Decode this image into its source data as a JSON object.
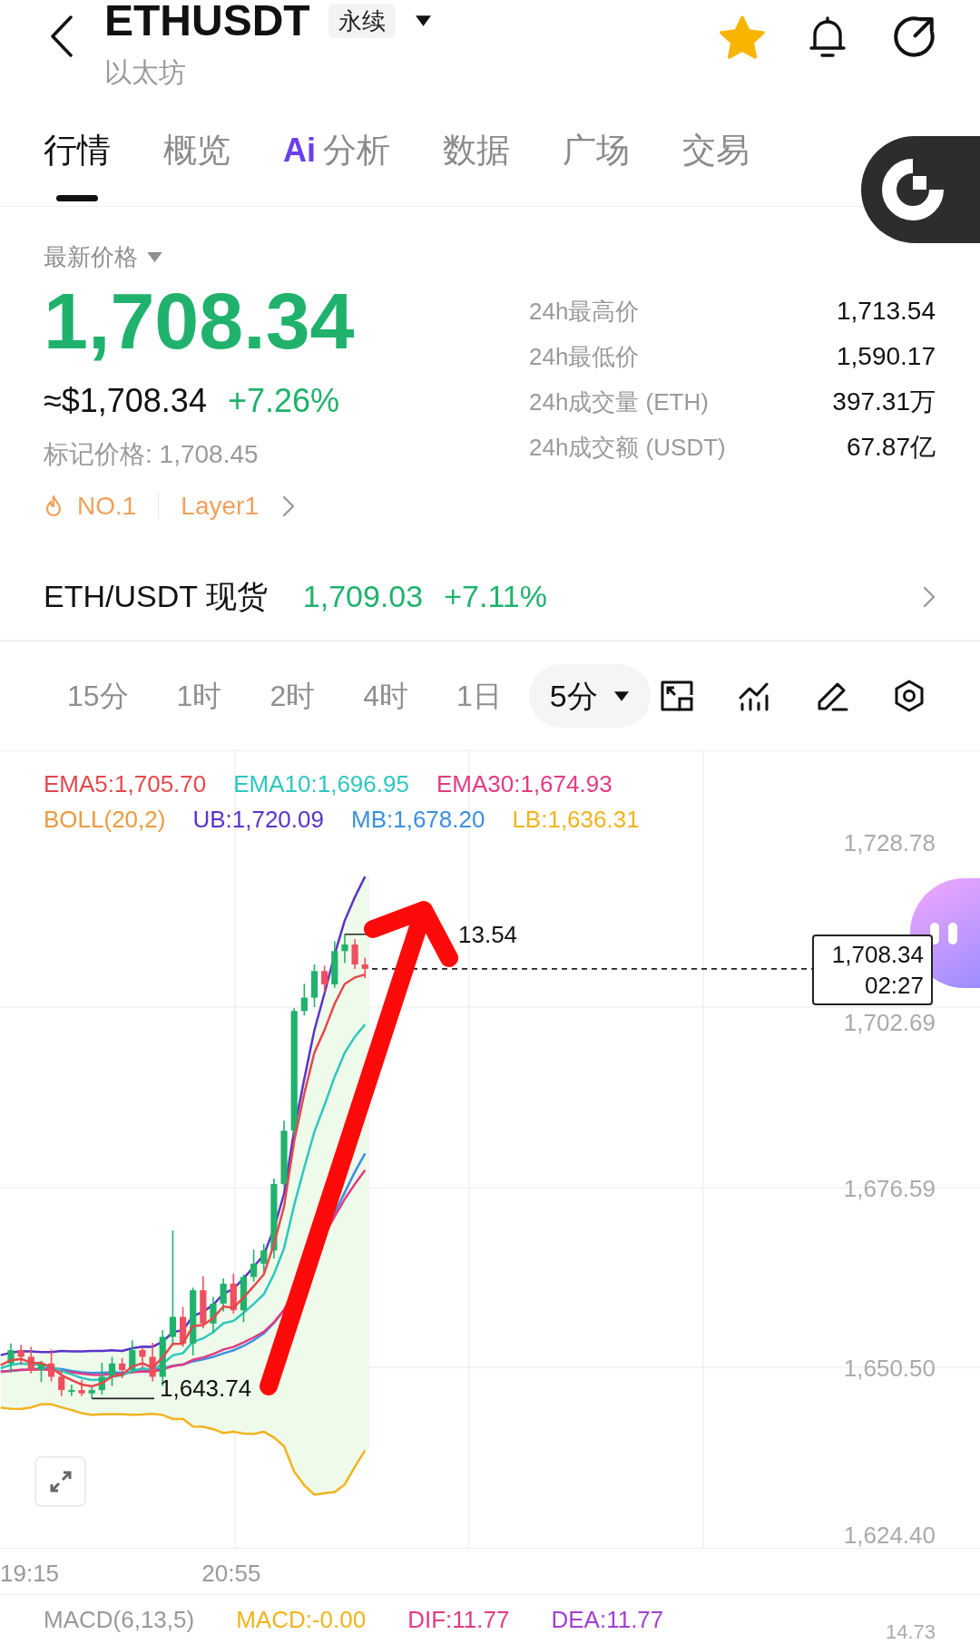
{
  "header": {
    "title": "ETHUSDT",
    "contract_badge": "永续",
    "subtitle": "以太坊",
    "favorite": true
  },
  "tabs": [
    {
      "label": "行情",
      "selected": true
    },
    {
      "label": "概览",
      "selected": false
    },
    {
      "label": "分析",
      "badge": "Ai",
      "selected": false
    },
    {
      "label": "数据",
      "selected": false
    },
    {
      "label": "广场",
      "selected": false
    },
    {
      "label": "交易",
      "selected": false
    }
  ],
  "price": {
    "label": "最新价格",
    "last": "1,708.34",
    "usd": "≈$1,708.34",
    "change": "+7.26%",
    "mark": "标记价格: 1,708.45",
    "tags": [
      {
        "kind": "rank",
        "text": "NO.1"
      },
      {
        "kind": "sector",
        "text": "Layer1"
      }
    ]
  },
  "stats": [
    {
      "label": "24h最高价",
      "value": "1,713.54"
    },
    {
      "label": "24h最低价",
      "value": "1,590.17"
    },
    {
      "label": "24h成交量 (ETH)",
      "value": "397.31万"
    },
    {
      "label": "24h成交额 (USDT)",
      "value": "67.87亿"
    }
  ],
  "spot": {
    "label": "ETH/USDT 现货",
    "price": "1,709.03",
    "change": "+7.11%"
  },
  "intervals": [
    {
      "label": "15分",
      "selected": false
    },
    {
      "label": "1时",
      "selected": false
    },
    {
      "label": "2时",
      "selected": false
    },
    {
      "label": "4时",
      "selected": false
    },
    {
      "label": "1日",
      "selected": false
    }
  ],
  "interval_dropdown": {
    "value": "5分"
  },
  "chart": {
    "ema_legend": [
      {
        "text": "EMA5:1,705.70",
        "color": "#e5484d"
      },
      {
        "text": "EMA10:1,696.95",
        "color": "#2ec7c0"
      },
      {
        "text": "EMA30:1,674.93",
        "color": "#e23a84"
      }
    ],
    "boll_legend": [
      {
        "text": "BOLL(20,2)",
        "color": "#eb9a3e"
      },
      {
        "text": "UB:1,720.09",
        "color": "#5a34c8"
      },
      {
        "text": "MB:1,678.20",
        "color": "#3b8fe0"
      },
      {
        "text": "LB:1,636.31",
        "color": "#f0b41c"
      }
    ],
    "y_axis": [
      "1,728.78",
      "1,702.69",
      "1,676.59",
      "1,650.50",
      "1,624.40"
    ],
    "x_axis": [
      "19:15",
      "20:55"
    ],
    "high_label": "13.54",
    "low_label": "1,643.74",
    "price_tag": {
      "price": "1,708.34",
      "countdown": "02:27"
    }
  },
  "macd": {
    "legend": [
      {
        "text": "MACD(6,13,5)",
        "color": "#999999"
      },
      {
        "text": "MACD:-0.00",
        "color": "#f0b41c"
      },
      {
        "text": "DIF:11.77",
        "color": "#e23a84"
      },
      {
        "text": "DEA:11.77",
        "color": "#a23fd0"
      }
    ],
    "axis_label": "14.73"
  }
}
